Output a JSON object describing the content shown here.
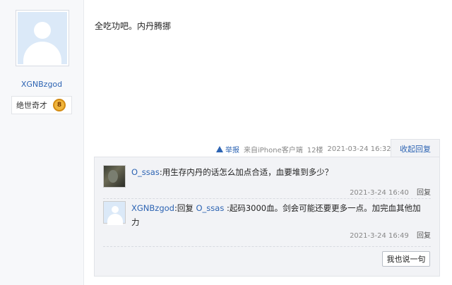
{
  "user": {
    "name": "XGNBzgod",
    "rank_title": "绝世奇才",
    "level": "8"
  },
  "post": {
    "content": "全吃功吧。内丹腾挪",
    "report_label": "举报",
    "source": "来自iPhone客户端",
    "floor": "12楼",
    "timestamp": "2021-03-24 16:32",
    "collapse_label": "收起回复"
  },
  "replies": [
    {
      "author": "O_ssas",
      "colon": ":",
      "text": "用生存内丹的话怎么加点合适，血要堆到多少？",
      "time": "2021-3-24 16:40",
      "reply_label": "回复"
    },
    {
      "author": "XGNBzgod",
      "colon": ":",
      "prefix": "回复 ",
      "target": "O_ssas",
      "text": " :起码3000血。剑会可能还要更多一点。加完血其他加力",
      "time": "2021-3-24 16:49",
      "reply_label": "回复"
    }
  ],
  "say_button_label": "我也说一句"
}
